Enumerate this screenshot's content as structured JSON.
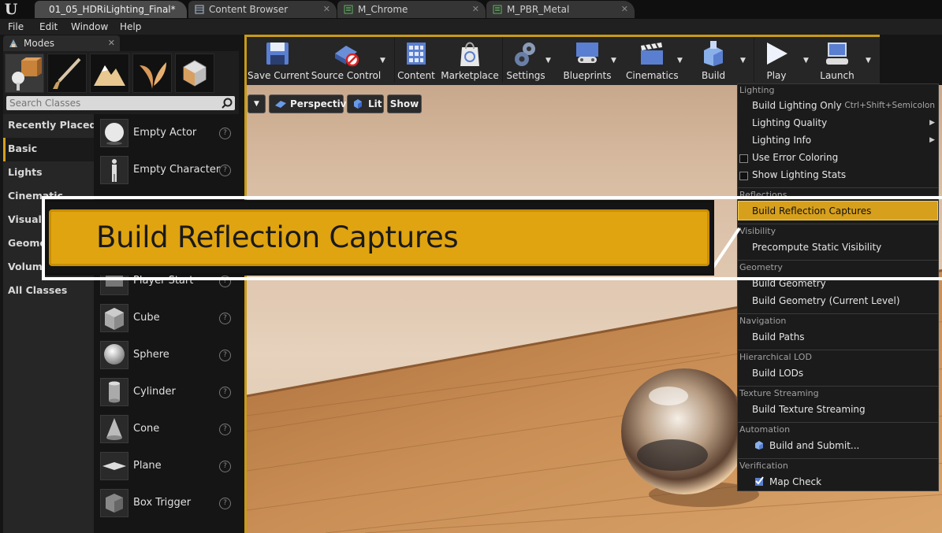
{
  "tabs": [
    {
      "label": "01_05_HDRiLighting_Final*",
      "active": true
    },
    {
      "label": "Content Browser"
    },
    {
      "label": "M_Chrome"
    },
    {
      "label": "M_PBR_Metal"
    }
  ],
  "menubar": [
    "File",
    "Edit",
    "Window",
    "Help"
  ],
  "modes": {
    "title": "Modes",
    "search_placeholder": "Search Classes",
    "categories": [
      "Recently Placed",
      "Basic",
      "Lights",
      "Cinematic",
      "Visual Effects",
      "Geometry",
      "Volumes",
      "All Classes"
    ],
    "selected_category": "Basic",
    "items": [
      "Empty Actor",
      "Empty Character",
      "",
      "",
      "Player Start",
      "Cube",
      "Sphere",
      "Cylinder",
      "Cone",
      "Plane",
      "Box Trigger"
    ]
  },
  "toolbar": {
    "save": "Save Current",
    "source": "Source Control",
    "content": "Content",
    "marketplace": "Marketplace",
    "settings": "Settings",
    "blueprints": "Blueprints",
    "cinematics": "Cinematics",
    "build": "Build",
    "play": "Play",
    "launch": "Launch"
  },
  "viewport": {
    "perspective": "Perspective",
    "lit": "Lit",
    "show": "Show"
  },
  "build_menu": {
    "lighting": "Lighting",
    "build_lighting_only": "Build Lighting Only",
    "build_lighting_shortcut": "Ctrl+Shift+Semicolon",
    "lighting_quality": "Lighting Quality",
    "lighting_info": "Lighting Info",
    "use_error_coloring": "Use Error Coloring",
    "show_lighting_stats": "Show Lighting Stats",
    "reflections": "Reflections",
    "build_reflection_captures": "Build Reflection Captures",
    "visibility": "Visibility",
    "precompute_static_visibility": "Precompute Static Visibility",
    "geometry": "Geometry",
    "build_geometry": "Build Geometry",
    "build_geometry_current": "Build Geometry (Current Level)",
    "navigation": "Navigation",
    "build_paths": "Build Paths",
    "hlod": "Hierarchical LOD",
    "build_lods": "Build LODs",
    "texture_streaming": "Texture Streaming",
    "build_texture_streaming": "Build Texture Streaming",
    "automation": "Automation",
    "build_and_submit": "Build and Submit...",
    "verification": "Verification",
    "map_check": "Map Check"
  },
  "callout": {
    "text": "Build Reflection Captures"
  },
  "colors": {
    "accent": "#d7a01c",
    "callout": "#e0a410"
  }
}
